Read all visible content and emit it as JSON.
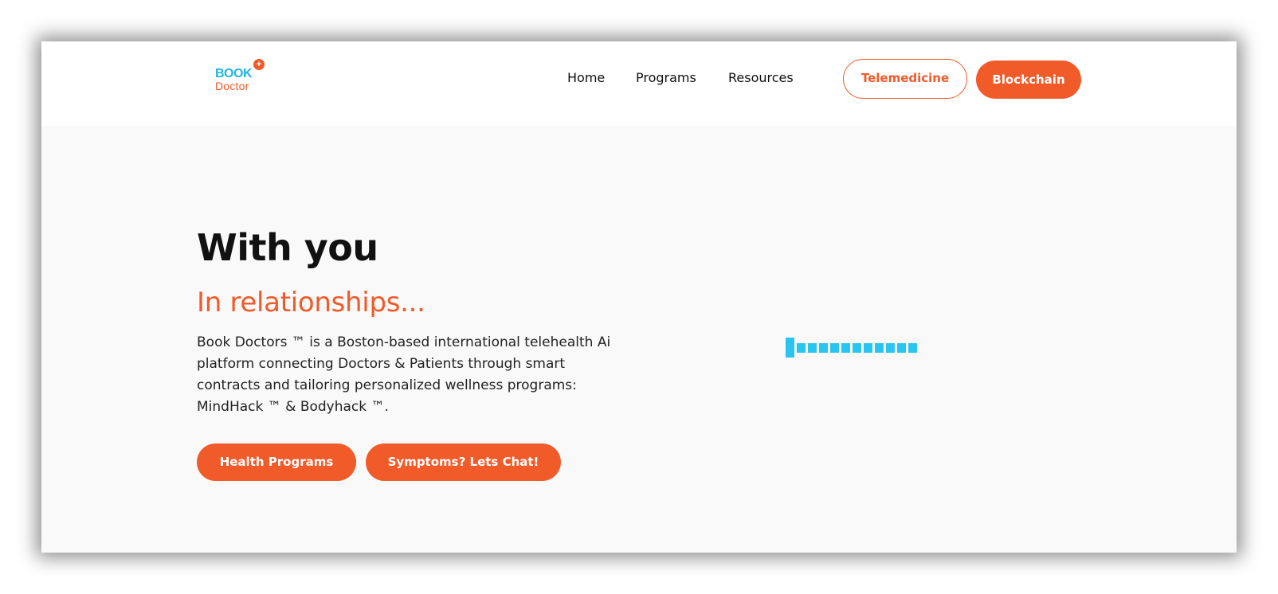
{
  "logo": {
    "line1": "BOOK",
    "line2": "Doctor",
    "badge": "+"
  },
  "nav": {
    "items": [
      "Home",
      "Programs",
      "Resources"
    ]
  },
  "header_buttons": {
    "telemedicine": "Telemedicine",
    "blockchain": "Blockchain"
  },
  "hero": {
    "title": "With you",
    "subtitle": "In relationships...",
    "description": "Book Doctors ™ is a Boston-based international telehealth Ai platform connecting Doctors & Patients through smart contracts and tailoring personalized wellness programs: MindHack ™ & Bodyhack ™.",
    "cta_primary": "Health Programs",
    "cta_secondary": "Symptoms? Lets Chat!"
  },
  "colors": {
    "accent": "#f15a29",
    "brand_blue": "#1fb6e4",
    "loader": "#29c5f0"
  },
  "icons": {
    "loader": "loading-bars-icon"
  }
}
